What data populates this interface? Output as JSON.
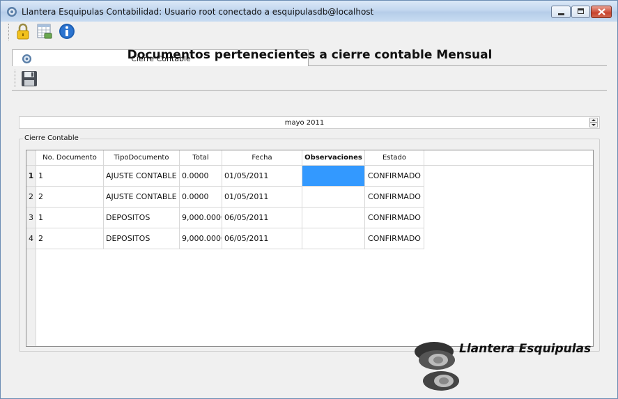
{
  "window": {
    "title": "Llantera Esquipulas Contabilidad: Usuario root conectado a esquipulasdb@localhost"
  },
  "toolbar": {
    "icons": [
      "lock-icon",
      "spreadsheet-icon",
      "info-icon"
    ]
  },
  "tab": {
    "label": "Cierre Contable"
  },
  "page": {
    "heading": "Documentos pertenecientes a cierre contable Mensual",
    "month_value": "mayo 2011",
    "group_title": "Cierre Contable"
  },
  "table": {
    "columns": [
      "No. Documento",
      "TipoDocumento",
      "Total",
      "Fecha",
      "Observaciones",
      "Estado"
    ],
    "row_numbers": [
      "1",
      "2",
      "3",
      "4"
    ],
    "rows": [
      [
        "1",
        "AJUSTE CONTABLE",
        "0.0000",
        "01/05/2011",
        "",
        "CONFIRMADO"
      ],
      [
        "2",
        "AJUSTE CONTABLE",
        "0.0000",
        "01/05/2011",
        "",
        "CONFIRMADO"
      ],
      [
        "1",
        "DEPOSITOS",
        "9,000.0000",
        "06/05/2011",
        "",
        "CONFIRMADO"
      ],
      [
        "2",
        "DEPOSITOS",
        "9,000.0000",
        "06/05/2011",
        "",
        "CONFIRMADO"
      ]
    ]
  },
  "logo": {
    "text": "Llantera Esquipulas"
  },
  "colors": {
    "selection": "#3399ff",
    "title_bar": "#c3d7ef",
    "close_button": "#c8432d"
  }
}
